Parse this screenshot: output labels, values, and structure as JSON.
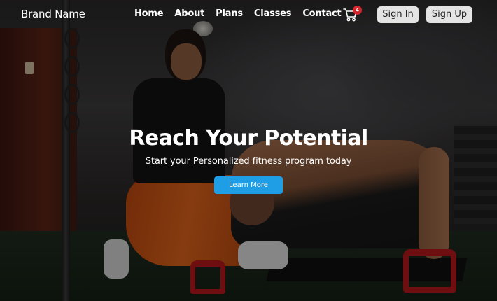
{
  "navbar": {
    "brand": "Brand Name",
    "links": [
      "Home",
      "About",
      "Plans",
      "Classes",
      "Contact"
    ],
    "cart": {
      "icon": "cart-icon",
      "count": "4",
      "badge_color": "#d6262b"
    },
    "sign_in": "Sign In",
    "sign_up": "Sign Up"
  },
  "hero": {
    "title": "Reach Your Potential",
    "subtitle": "Start your Personalized fitness program today",
    "cta": "Learn More",
    "cta_color": "#1f9ee6"
  }
}
